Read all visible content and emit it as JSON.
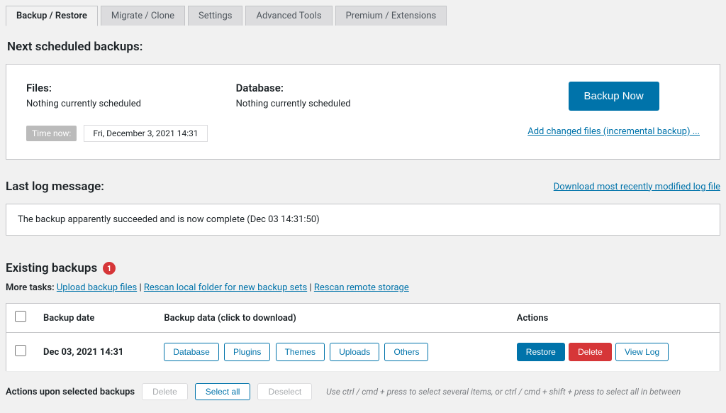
{
  "tabs": [
    {
      "label": "Backup / Restore",
      "active": true
    },
    {
      "label": "Migrate / Clone",
      "active": false
    },
    {
      "label": "Settings",
      "active": false
    },
    {
      "label": "Advanced Tools",
      "active": false
    },
    {
      "label": "Premium / Extensions",
      "active": false
    }
  ],
  "next_heading": "Next scheduled backups:",
  "files": {
    "title": "Files:",
    "status": "Nothing currently scheduled"
  },
  "database": {
    "title": "Database:",
    "status": "Nothing currently scheduled"
  },
  "backup_now_label": "Backup Now",
  "incremental_link": "Add changed files (incremental backup) ...",
  "time_now_label": "Time now:",
  "time_now_value": "Fri, December 3, 2021 14:31",
  "log_heading": "Last log message:",
  "log_download_link": "Download most recently modified log file",
  "log_message": "The backup apparently succeeded and is now complete (Dec 03 14:31:50)",
  "existing_heading": "Existing backups",
  "existing_count": "1",
  "more_tasks": {
    "prefix": "More tasks:",
    "links": [
      "Upload backup files",
      "Rescan local folder for new backup sets",
      "Rescan remote storage"
    ]
  },
  "table": {
    "headers": {
      "date": "Backup date",
      "data": "Backup data (click to download)",
      "actions": "Actions"
    },
    "rows": [
      {
        "date": "Dec 03, 2021 14:31",
        "data_buttons": [
          "Database",
          "Plugins",
          "Themes",
          "Uploads",
          "Others"
        ],
        "actions": {
          "restore": "Restore",
          "delete": "Delete",
          "log": "View Log"
        }
      }
    ]
  },
  "bulk": {
    "label": "Actions upon selected backups",
    "delete": "Delete",
    "select_all": "Select all",
    "deselect": "Deselect",
    "hint": "Use ctrl / cmd + press to select several items, or ctrl / cmd + shift + press to select all in between"
  }
}
